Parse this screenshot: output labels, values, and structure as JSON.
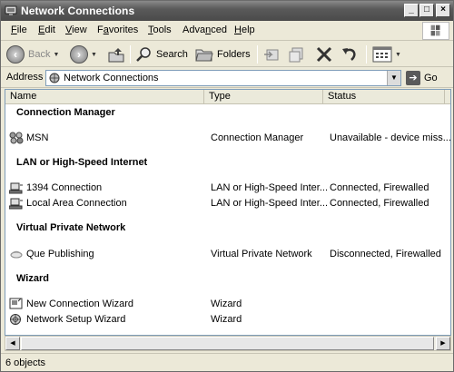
{
  "window": {
    "title": "Network Connections",
    "controls": {
      "minimize": "_",
      "maximize": "□",
      "close": "×"
    }
  },
  "menu": {
    "items": [
      {
        "label": "File",
        "hotkey": "F"
      },
      {
        "label": "Edit",
        "hotkey": "E"
      },
      {
        "label": "View",
        "hotkey": "V"
      },
      {
        "label": "Favorites",
        "hotkey": "a"
      },
      {
        "label": "Tools",
        "hotkey": "T"
      },
      {
        "label": "Advanced",
        "hotkey": "n"
      },
      {
        "label": "Help",
        "hotkey": "H"
      }
    ]
  },
  "toolbar": {
    "back_label": "Back",
    "search_label": "Search",
    "folders_label": "Folders"
  },
  "address": {
    "label": "Address",
    "value": "Network Connections",
    "go_label": "Go"
  },
  "columns": [
    "Name",
    "Type",
    "Status"
  ],
  "groups": [
    {
      "title": "Connection Manager",
      "items": [
        {
          "name": "MSN",
          "type": "Connection Manager",
          "status": "Unavailable - device miss...",
          "icon": "msn-icon"
        }
      ]
    },
    {
      "title": "LAN or High-Speed Internet",
      "items": [
        {
          "name": "1394 Connection",
          "type": "LAN or High-Speed Inter...",
          "status": "Connected, Firewalled",
          "icon": "lan-connection-icon"
        },
        {
          "name": "Local Area Connection",
          "type": "LAN or High-Speed Inter...",
          "status": "Connected, Firewalled",
          "icon": "lan-connection-icon"
        }
      ]
    },
    {
      "title": "Virtual Private Network",
      "items": [
        {
          "name": "Que Publishing",
          "type": "Virtual Private Network",
          "status": "Disconnected, Firewalled",
          "icon": "vpn-icon"
        }
      ]
    },
    {
      "title": "Wizard",
      "items": [
        {
          "name": "New Connection Wizard",
          "type": "Wizard",
          "status": "",
          "icon": "new-connection-wizard-icon"
        },
        {
          "name": "Network Setup Wizard",
          "type": "Wizard",
          "status": "",
          "icon": "network-setup-wizard-icon"
        }
      ]
    }
  ],
  "statusbar": {
    "text": "6 objects"
  }
}
